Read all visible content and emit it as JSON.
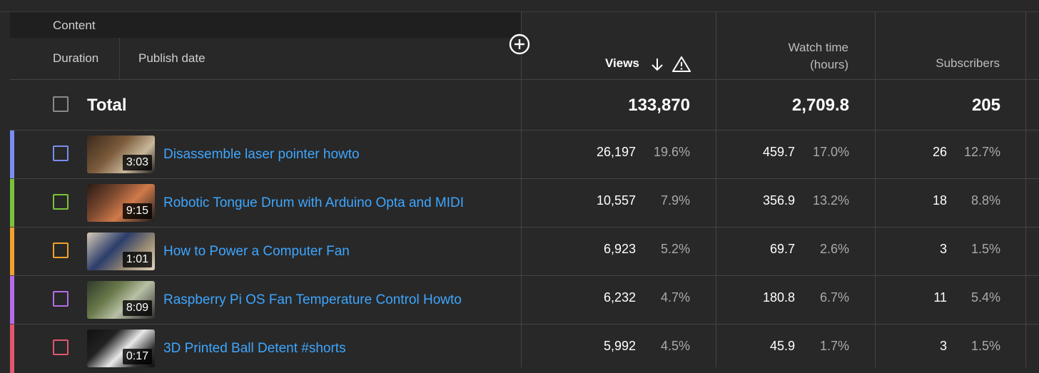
{
  "header": {
    "content": "Content",
    "duration": "Duration",
    "publish_date": "Publish date",
    "views": "Views",
    "watch_time_line1": "Watch time",
    "watch_time_line2": "(hours)",
    "subscribers": "Subscribers",
    "sort_icon": "arrow-down-icon",
    "warning_icon": "warning-triangle-icon",
    "add_column_icon": "add-circle-icon"
  },
  "total": {
    "label": "Total",
    "views": "133,870",
    "watch_time": "2,709.8",
    "subscribers": "205"
  },
  "rows": [
    {
      "color": "#7b8df0",
      "duration": "3:03",
      "title": "Disassemble laser pointer howto",
      "views": "26,197",
      "views_pct": "19.6%",
      "watch": "459.7",
      "watch_pct": "17.0%",
      "subs": "26",
      "subs_pct": "12.7%"
    },
    {
      "color": "#7cc23a",
      "duration": "9:15",
      "title": "Robotic Tongue Drum with Arduino Opta and MIDI",
      "views": "10,557",
      "views_pct": "7.9%",
      "watch": "356.9",
      "watch_pct": "13.2%",
      "subs": "18",
      "subs_pct": "8.8%"
    },
    {
      "color": "#f0a22c",
      "duration": "1:01",
      "title": "How to Power a Computer Fan",
      "views": "6,923",
      "views_pct": "5.2%",
      "watch": "69.7",
      "watch_pct": "2.6%",
      "subs": "3",
      "subs_pct": "1.5%"
    },
    {
      "color": "#b46de8",
      "duration": "8:09",
      "title": "Raspberry Pi OS Fan Temperature Control Howto",
      "views": "6,232",
      "views_pct": "4.7%",
      "watch": "180.8",
      "watch_pct": "6.7%",
      "subs": "11",
      "subs_pct": "5.4%"
    },
    {
      "color": "#e0576f",
      "duration": "0:17",
      "title": "3D Printed Ball Detent #shorts",
      "views": "5,992",
      "views_pct": "4.5%",
      "watch": "45.9",
      "watch_pct": "1.7%",
      "subs": "3",
      "subs_pct": "1.5%"
    }
  ]
}
